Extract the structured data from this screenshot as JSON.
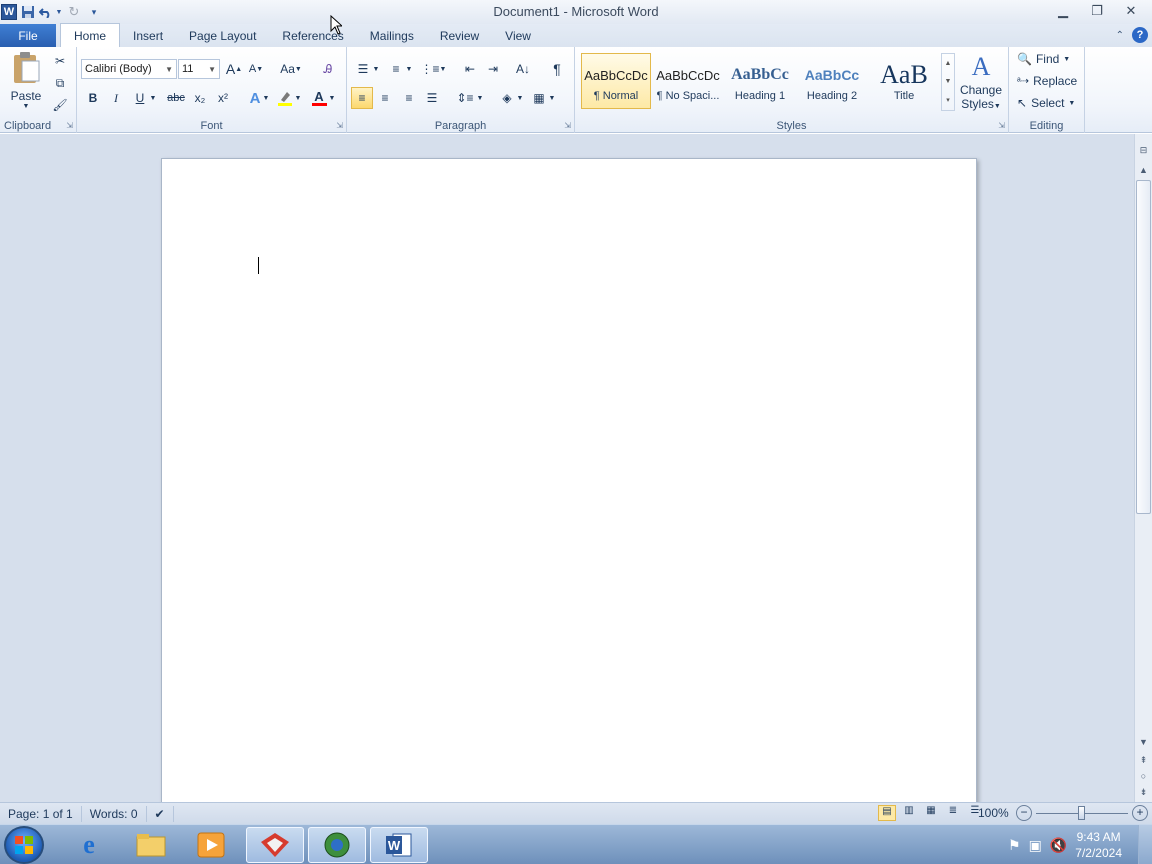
{
  "window": {
    "title": "Document1  -  Microsoft Word",
    "app_icon": "W"
  },
  "tabs": [
    "File",
    "Home",
    "Insert",
    "Page Layout",
    "References",
    "Mailings",
    "Review",
    "View"
  ],
  "active_tab": "Home",
  "clipboard": {
    "paste_label": "Paste",
    "group_label": "Clipboard"
  },
  "font": {
    "font_name": "Calibri (Body)",
    "font_size": "11",
    "group_label": "Font",
    "bold": "B",
    "italic": "I",
    "underline": "U",
    "strike": "abc",
    "subscript": "x₂",
    "superscript": "x²",
    "change_case": "Aa",
    "grow": "A",
    "shrink": "A"
  },
  "paragraph": {
    "group_label": "Paragraph",
    "pilcrow": "¶"
  },
  "styles": {
    "group_label": "Styles",
    "items": [
      {
        "preview": "AaBbCcDc",
        "name": "¶ Normal"
      },
      {
        "preview": "AaBbCcDc",
        "name": "¶ No Spaci..."
      },
      {
        "preview": "AaBbCc",
        "name": "Heading 1"
      },
      {
        "preview": "AaBbCc",
        "name": "Heading 2"
      },
      {
        "preview": "AaB",
        "name": "Title"
      }
    ],
    "change_styles_line1": "Change",
    "change_styles_line2": "Styles"
  },
  "editing": {
    "group_label": "Editing",
    "find": "Find",
    "replace": "Replace",
    "select": "Select"
  },
  "status": {
    "page": "Page: 1 of 1",
    "words": "Words: 0",
    "zoom": "100%",
    "zoom_level": 1.0
  },
  "taskbar": {
    "time": "9:43 AM",
    "date": "7/2/2024"
  },
  "colors": {
    "file_tab": "#2a5fb0",
    "highlight_color": "#ffff00",
    "font_color": "#ff0000",
    "selected_style_border": "#e3b94b"
  }
}
